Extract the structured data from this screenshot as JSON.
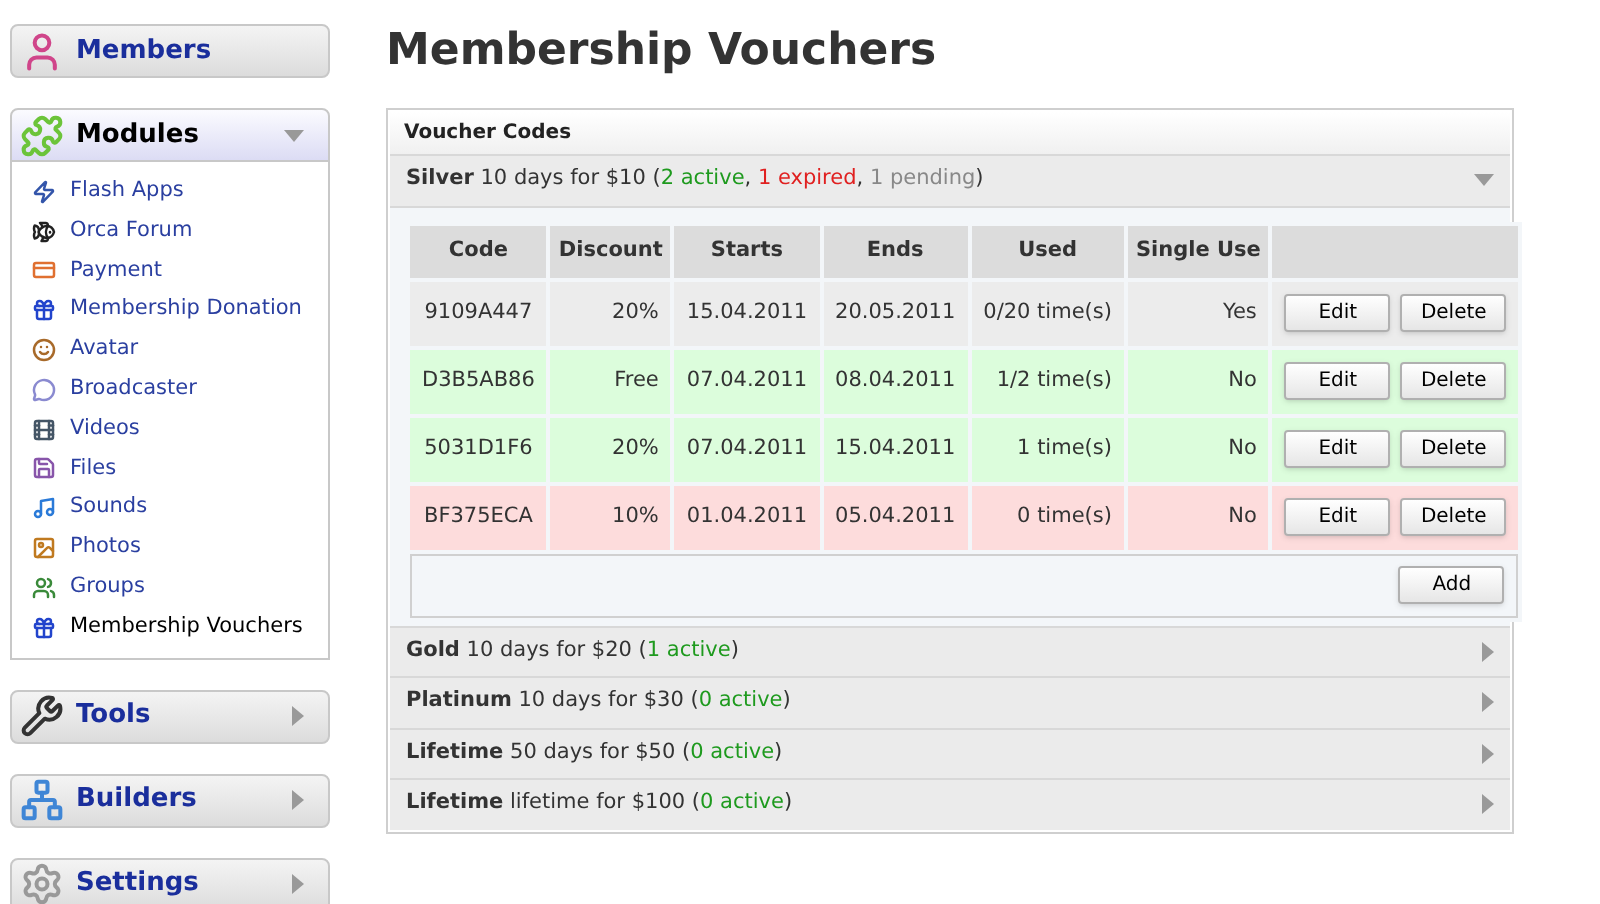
{
  "sidebar": {
    "sections": [
      {
        "kind": "members",
        "title": "Members"
      },
      {
        "kind": "modules",
        "title": "Modules",
        "expanded": true,
        "items": [
          {
            "label": "Flash Apps",
            "selected": false
          },
          {
            "label": "Orca Forum",
            "selected": false
          },
          {
            "label": "Payment",
            "selected": false
          },
          {
            "label": "Membership Donation",
            "selected": false
          },
          {
            "label": "Avatar",
            "selected": false
          },
          {
            "label": "Broadcaster",
            "selected": false
          },
          {
            "label": "Videos",
            "selected": false
          },
          {
            "label": "Files",
            "selected": false
          },
          {
            "label": "Sounds",
            "selected": false
          },
          {
            "label": "Photos",
            "selected": false
          },
          {
            "label": "Groups",
            "selected": false
          },
          {
            "label": "Membership Vouchers",
            "selected": true
          }
        ]
      },
      {
        "kind": "tools",
        "title": "Tools",
        "expanded": false
      },
      {
        "kind": "builders",
        "title": "Builders",
        "expanded": false
      },
      {
        "kind": "settings",
        "title": "Settings",
        "expanded": false
      }
    ]
  },
  "page": {
    "title": "Membership Vouchers"
  },
  "panel": {
    "title": "Voucher Codes",
    "plans": [
      {
        "name": "Silver",
        "description": "10 days for $10",
        "parts": [
          {
            "kind": "plain",
            "text": "("
          },
          {
            "kind": "active",
            "text": "2 active"
          },
          {
            "kind": "plain",
            "text": ", "
          },
          {
            "kind": "expired",
            "text": "1 expired"
          },
          {
            "kind": "plain",
            "text": ", "
          },
          {
            "kind": "pending",
            "text": "1 pending"
          },
          {
            "kind": "plain",
            "text": ")"
          }
        ],
        "expanded": true,
        "table": {
          "columns": [
            "Code",
            "Discount",
            "Starts",
            "Ends",
            "Used",
            "Single Use"
          ],
          "rows": [
            {
              "kind": "pending",
              "cells": [
                "9109A447",
                "20%",
                "15.04.2011",
                "20.05.2011",
                "0/20 time(s)",
                "Yes"
              ],
              "buttons": [
                "Edit",
                "Delete"
              ]
            },
            {
              "kind": "active",
              "cells": [
                "D3B5AB86",
                "Free",
                "07.04.2011",
                "08.04.2011",
                "1/2 time(s)",
                "No"
              ],
              "buttons": [
                "Edit",
                "Delete"
              ]
            },
            {
              "kind": "active",
              "cells": [
                "5031D1F6",
                "20%",
                "07.04.2011",
                "15.04.2011",
                "1 time(s)",
                "No"
              ],
              "buttons": [
                "Edit",
                "Delete"
              ]
            },
            {
              "kind": "expired",
              "cells": [
                "BF375ECA",
                "10%",
                "01.04.2011",
                "05.04.2011",
                "0 time(s)",
                "No"
              ],
              "buttons": [
                "Edit",
                "Delete"
              ]
            }
          ],
          "add_button": "Add"
        }
      },
      {
        "name": "Gold",
        "description": "10 days for $20",
        "parts": [
          {
            "kind": "plain",
            "text": "("
          },
          {
            "kind": "active",
            "text": "1 active"
          },
          {
            "kind": "plain",
            "text": ")"
          }
        ],
        "expanded": false
      },
      {
        "name": "Platinum",
        "description": "10 days for $30",
        "parts": [
          {
            "kind": "plain",
            "text": "("
          },
          {
            "kind": "active",
            "text": "0 active"
          },
          {
            "kind": "plain",
            "text": ")"
          }
        ],
        "expanded": false
      },
      {
        "name": "Lifetime",
        "description": "50 days for $50",
        "parts": [
          {
            "kind": "plain",
            "text": "("
          },
          {
            "kind": "active",
            "text": "0 active"
          },
          {
            "kind": "plain",
            "text": ")"
          }
        ],
        "expanded": false
      },
      {
        "name": "Lifetime",
        "description": "lifetime for $100",
        "parts": [
          {
            "kind": "plain",
            "text": "("
          },
          {
            "kind": "active",
            "text": "0 active"
          },
          {
            "kind": "plain",
            "text": ")"
          }
        ],
        "expanded": false
      }
    ]
  }
}
